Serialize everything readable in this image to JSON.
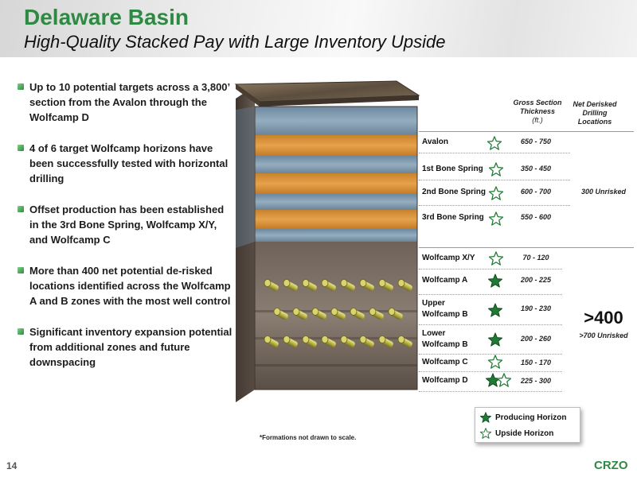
{
  "header": {
    "title": "Delaware Basin",
    "subtitle": "High-Quality Stacked Pay with Large Inventory Upside"
  },
  "bullets": [
    "Up to 10 potential targets across a 3,800’ section from the Avalon through the Wolfcamp D",
    "4 of 6 target Wolfcamp horizons have been successfully tested with horizontal drilling",
    "Offset production has been established in the 3rd Bone Spring, Wolfcamp X/Y, and Wolfcamp C",
    "More than 400 net potential de-risked locations identified across the Wolfcamp A and B zones with the most well control",
    "Significant inventory expansion potential from additional zones and future downspacing"
  ],
  "table": {
    "col_thickness_line1": "Gross Section",
    "col_thickness_line2": "Thickness",
    "col_thickness_unit": "(ft.)",
    "col_locations_line1": "Net Derisked",
    "col_locations_line2": "Drilling",
    "col_locations_line3": "Locations",
    "formations": [
      {
        "name": "Avalon",
        "thickness": "650 - 750",
        "stars": [
          "upside"
        ]
      },
      {
        "name": "1st Bone Spring",
        "thickness": "350 - 450",
        "stars": [
          "upside"
        ]
      },
      {
        "name": "2nd Bone Spring",
        "thickness": "600 - 700",
        "stars": [
          "upside"
        ]
      },
      {
        "name": "3rd Bone Spring",
        "thickness": "550 - 600",
        "stars": [
          "upside"
        ]
      },
      {
        "name": "Wolfcamp X/Y",
        "thickness": "70 - 120",
        "stars": [
          "upside"
        ]
      },
      {
        "name": "Wolfcamp A",
        "thickness": "200 - 225",
        "stars": [
          "producing"
        ]
      },
      {
        "name": "Upper Wolfcamp B",
        "thickness": "190 - 230",
        "stars": [
          "producing"
        ]
      },
      {
        "name": "Lower Wolfcamp B",
        "thickness": "200 - 260",
        "stars": [
          "producing"
        ]
      },
      {
        "name": "Wolfcamp C",
        "thickness": "150 - 170",
        "stars": [
          "upside"
        ]
      },
      {
        "name": "Wolfcamp D",
        "thickness": "225 - 300",
        "stars": [
          "producing",
          "upside"
        ]
      }
    ],
    "upper_locations": "300 Unrisked",
    "lower_locations_big": ">400",
    "lower_locations_small": ">700 Unrisked"
  },
  "legend": {
    "producing": "Producing Horizon",
    "upside": "Upside Horizon"
  },
  "footnote": "*Formations not drawn to scale.",
  "footer": {
    "page_number": "14",
    "logo": "CRZO"
  },
  "colors": {
    "brand_green": "#2e8a42",
    "star_green": "#1f7a34",
    "sand_orange": "#d98f32",
    "water_blue": "#7d97ac",
    "shale_brown": "#6b5d52"
  }
}
